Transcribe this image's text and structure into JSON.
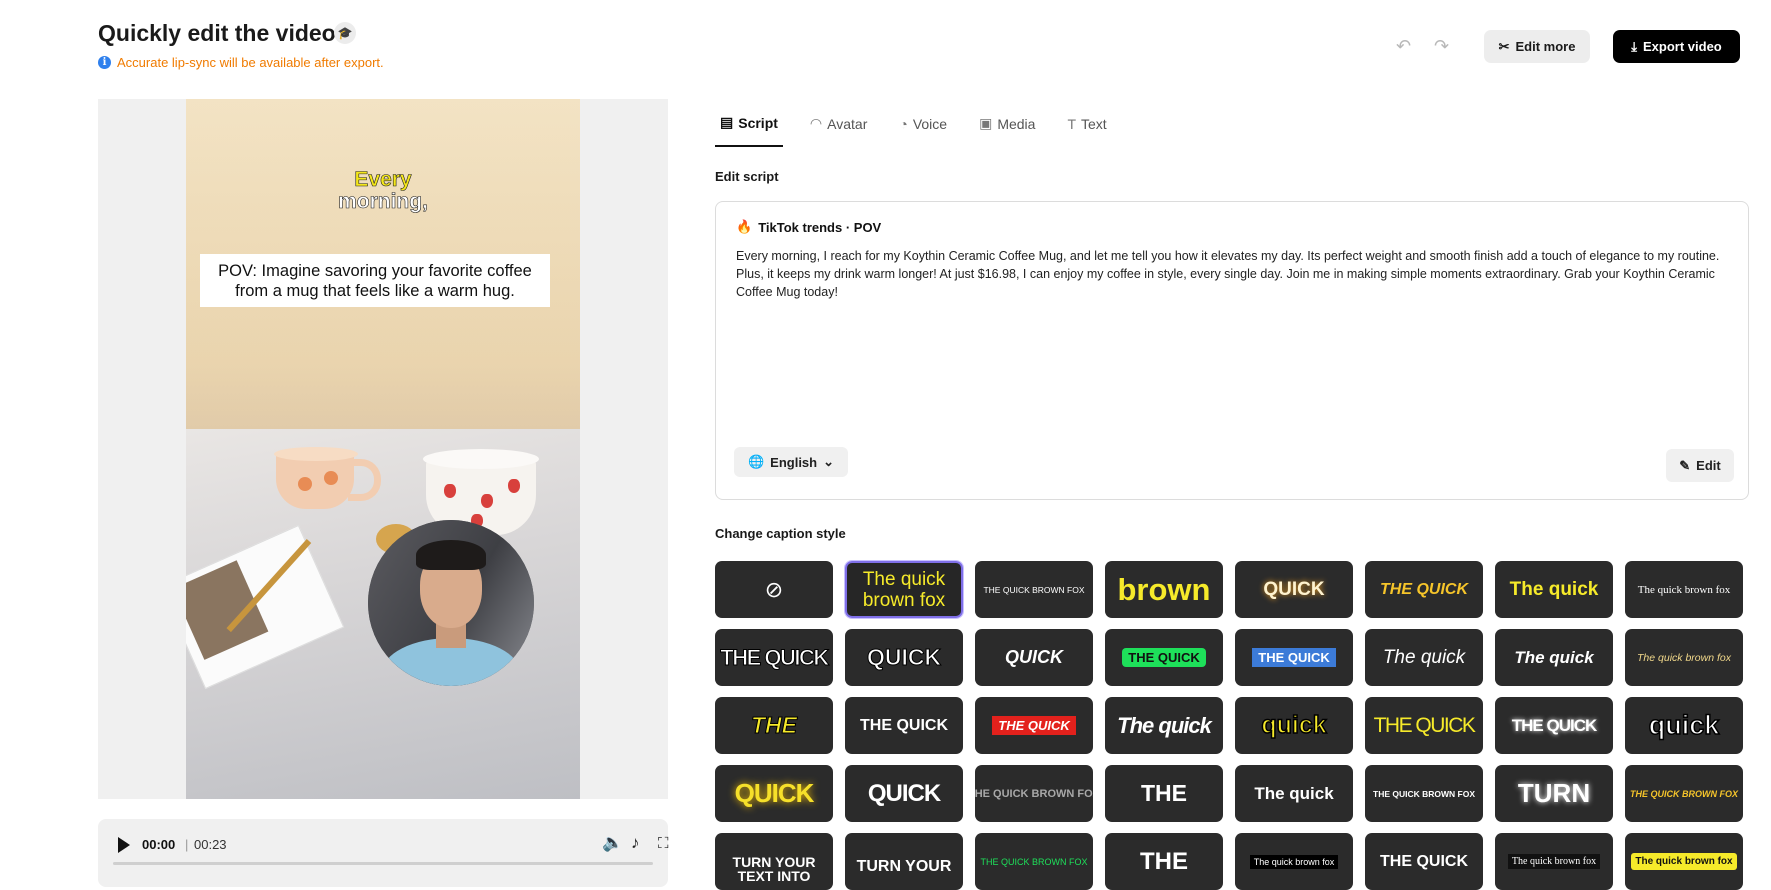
{
  "header": {
    "title": "Quickly edit the video",
    "notice": "Accurate lip-sync will be available after export.",
    "edit_more": "Edit more",
    "export": "Export video"
  },
  "preview": {
    "caption_top_highlight": "Every",
    "caption_top_rest": "morning,",
    "pov_text": "POV: Imagine savoring your favorite coffee from a mug that feels like a warm hug."
  },
  "player": {
    "current_time": "00:00",
    "separator": "|",
    "duration": "00:23"
  },
  "tabs": [
    {
      "label": "Script",
      "icon": "script-icon",
      "active": true
    },
    {
      "label": "Avatar",
      "icon": "avatar-icon",
      "active": false
    },
    {
      "label": "Voice",
      "icon": "voice-icon",
      "active": false
    },
    {
      "label": "Media",
      "icon": "media-icon",
      "active": false
    },
    {
      "label": "Text",
      "icon": "text-icon",
      "active": false
    }
  ],
  "script": {
    "section_label": "Edit script",
    "trend_label": "TikTok trends · POV",
    "text": "Every morning, I reach for my Koythin Ceramic Coffee Mug, and let me tell you how it elevates my day. Its perfect weight and smooth finish add a touch of elegance to my routine. Plus, it keeps my drink warm longer! At just $16.98, I can enjoy my coffee in style, every single day. Join me in making simple moments extraordinary. Grab your Koythin Ceramic Coffee Mug today!",
    "language": "English",
    "edit_label": "Edit"
  },
  "caption_style": {
    "section_label": "Change caption style",
    "styles": [
      {
        "text": "",
        "icon": "none-icon"
      },
      {
        "text": "The quick brown fox",
        "selected": true
      },
      {
        "text": "THE QUICK BROWN FOX"
      },
      {
        "text": "brown"
      },
      {
        "text": "QUICK"
      },
      {
        "text": "THE QUICK"
      },
      {
        "text": "The quick"
      },
      {
        "text": "The quick brown fox"
      },
      {
        "text": "THE QUICK"
      },
      {
        "text": "QUICK"
      },
      {
        "text": "QUICK"
      },
      {
        "text": "THE QUICK"
      },
      {
        "text": "THE QUICK"
      },
      {
        "text": "The quick"
      },
      {
        "text": "The quick"
      },
      {
        "text": "The quick brown fox"
      },
      {
        "text": "THE"
      },
      {
        "text": "THE QUICK"
      },
      {
        "text": "THE QUICK"
      },
      {
        "text": "The quick"
      },
      {
        "text": "quick"
      },
      {
        "text": "THE QUICK"
      },
      {
        "text": "THE QUICK"
      },
      {
        "text": "quick"
      },
      {
        "text": "QUICK"
      },
      {
        "text": "QUICK"
      },
      {
        "text": "THE QUICK BROWN FOX"
      },
      {
        "text": "THE"
      },
      {
        "text": "The quick"
      },
      {
        "text": "THE QUICK BROWN FOX"
      },
      {
        "text": "TURN"
      },
      {
        "text": "THE QUICK BROWN FOX"
      },
      {
        "text": "TURN YOUR TEXT INTO"
      },
      {
        "text": "TURN YOUR"
      },
      {
        "text": "THE QUICK BROWN FOX"
      },
      {
        "text": "THE"
      },
      {
        "text": "The quick brown fox"
      },
      {
        "text": "THE QUICK"
      },
      {
        "text": "The quick brown fox"
      },
      {
        "text": "The quick brown fox"
      }
    ]
  }
}
